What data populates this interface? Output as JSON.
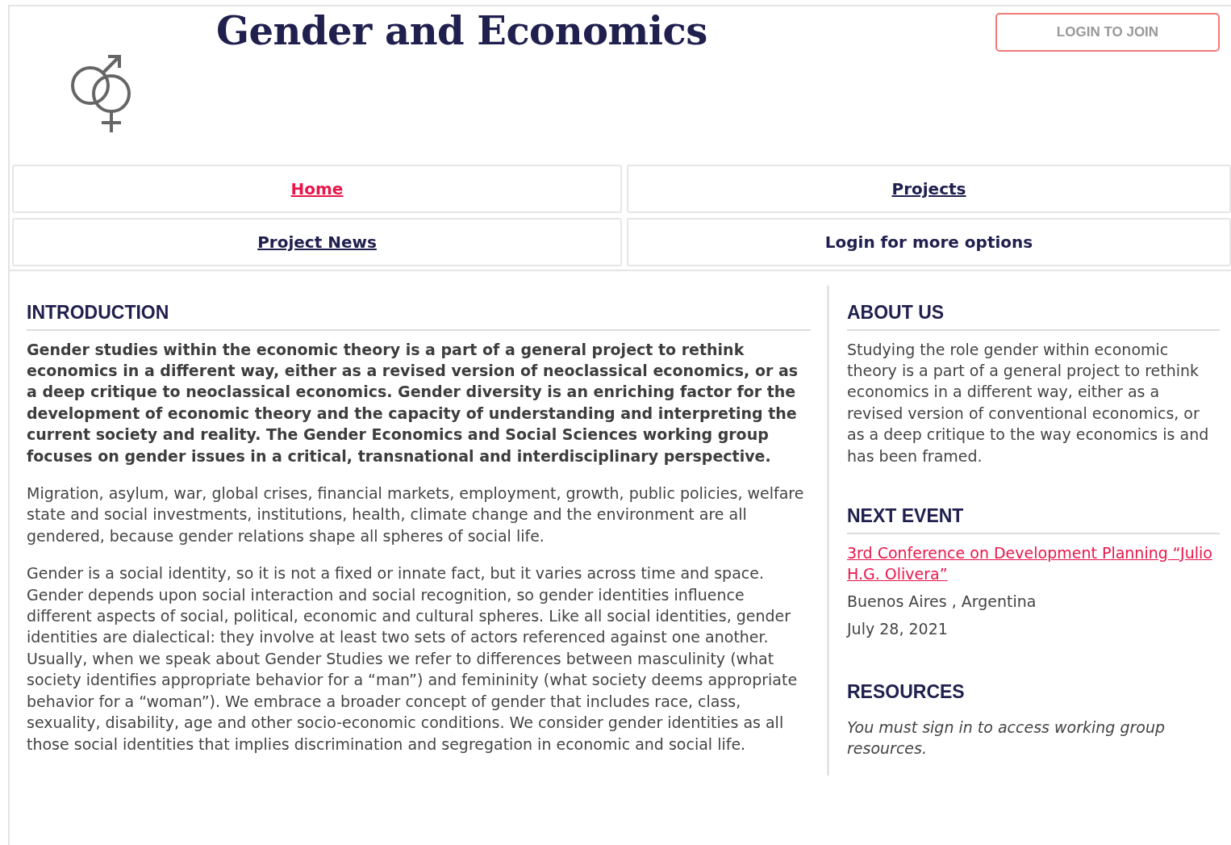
{
  "header": {
    "title": "Gender and Economics",
    "login_button": "LOGIN TO JOIN"
  },
  "nav": [
    {
      "label": "Home",
      "kind": "link",
      "selected": true
    },
    {
      "label": "Projects",
      "kind": "link",
      "selected": false
    },
    {
      "label": "Project News",
      "kind": "link",
      "selected": false
    },
    {
      "label": "Login for more options",
      "kind": "text",
      "selected": false
    }
  ],
  "introduction": {
    "heading": "INTRODUCTION",
    "paragraphs": [
      {
        "kind": "lead",
        "text": "Gender studies within the economic theory is a part of a general project to rethink economics in a different way, either as a revised version of neoclassical economics, or as a deep critique to neoclassical economics. Gender diversity is an enriching factor for the development of economic theory and the capacity of understanding and interpreting the current society and reality. The Gender Economics and Social Sciences working group focuses on gender issues in a critical, transnational and interdisciplinary perspective."
      },
      {
        "kind": "body",
        "text": "Migration, asylum, war, global crises, financial markets, employment, growth, public policies, welfare state and social investments, institutions, health, climate change and the environment are all gendered, because gender relations shape all spheres of social life."
      },
      {
        "kind": "body",
        "text": "Gender is a social identity, so it is not a fixed or innate fact, but it varies across time and space. Gender depends upon social interaction and social recognition, so gender identities influence different aspects of social, political, economic and cultural spheres. Like all social identities, gender identities are dialectical: they involve at least two sets of actors referenced against one another. Usually, when we speak about Gender Studies we refer to differences between masculinity (what society identifies appropriate behavior for a “man”) and femininity (what society deems appropriate behavior for a “woman”). We embrace a broader concept of gender that includes race, class, sexuality, disability, age and other socio-economic conditions. We consider gender identities as all those social identities that implies discrimination and segregation in economic and social life."
      }
    ]
  },
  "about_us": {
    "heading": "ABOUT US",
    "text": "Studying the role gender within economic theory is a part of a general project to rethink economics in a different way, either as a revised version of conventional economics, or as a deep critique to the way economics is and has been framed."
  },
  "next_event": {
    "heading": "NEXT EVENT",
    "link": "3rd Conference on Development Planning “Julio H.G. Olivera”",
    "location": "Buenos Aires , Argentina",
    "date": "July 28, 2021"
  },
  "resources": {
    "heading": "RESOURCES",
    "note": "You must sign in to access working group resources."
  }
}
